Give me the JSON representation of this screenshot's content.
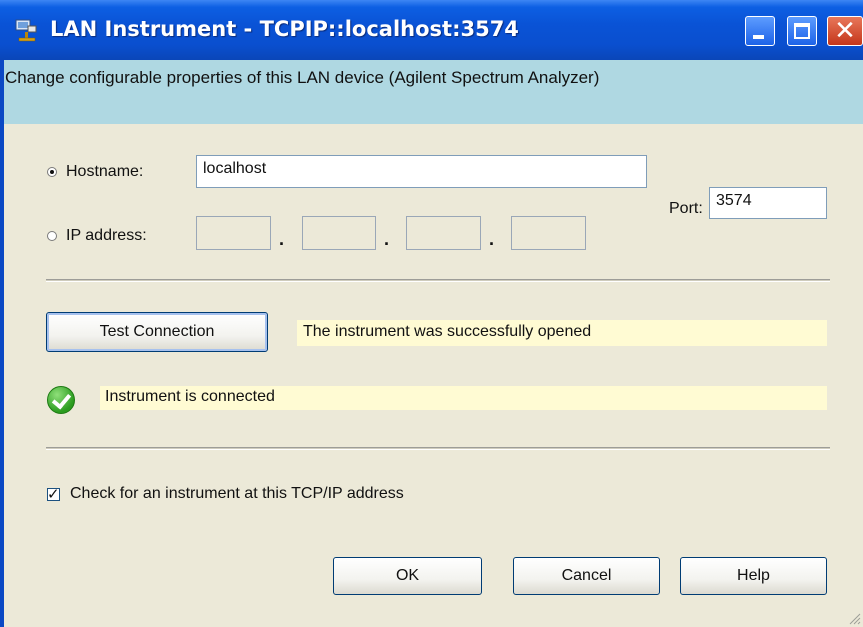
{
  "window": {
    "title": "LAN Instrument - TCPIP::localhost:3574",
    "controls": [
      "minimize",
      "maximize",
      "close"
    ]
  },
  "header": {
    "description": "Change configurable properties of this LAN device (Agilent Spectrum Analyzer)"
  },
  "address": {
    "hostname_label": "Hostname:",
    "hostname_value": "localhost",
    "hostname_selected": true,
    "ip_label": "IP address:",
    "ip_octets": [
      "",
      "",
      "",
      ""
    ],
    "ip_separator": ".",
    "port_label": "Port:",
    "port_value": "3574"
  },
  "test": {
    "button_label": "Test Connection",
    "result_message": "The instrument was successfully opened",
    "status_message": "Instrument is connected"
  },
  "options": {
    "check_label": "Check for an instrument at this TCP/IP address",
    "checked": true
  },
  "buttons": {
    "ok": "OK",
    "cancel": "Cancel",
    "help": "Help"
  },
  "colors": {
    "titlebar": "#0a53d6",
    "header_band": "#afd8e2",
    "status_highlight": "#fffbd3",
    "dialog_bg": "#ece9d8"
  },
  "icons": {
    "app": "lan-instrument-icon",
    "status": "green-check-icon"
  }
}
